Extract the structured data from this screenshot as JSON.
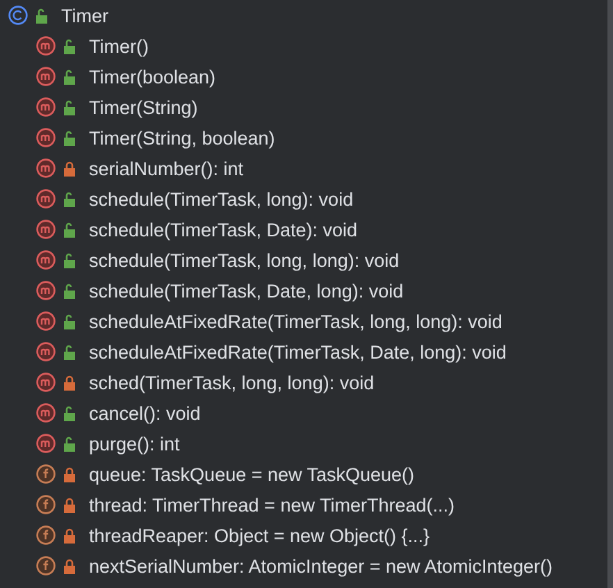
{
  "structure": {
    "label": "Timer",
    "kind": "class",
    "locked": false,
    "children": [
      {
        "label": "Timer()",
        "kind": "method",
        "locked": false
      },
      {
        "label": "Timer(boolean)",
        "kind": "method",
        "locked": false
      },
      {
        "label": "Timer(String)",
        "kind": "method",
        "locked": false
      },
      {
        "label": "Timer(String, boolean)",
        "kind": "method",
        "locked": false
      },
      {
        "label": "serialNumber(): int",
        "kind": "method",
        "locked": true
      },
      {
        "label": "schedule(TimerTask, long): void",
        "kind": "method",
        "locked": false
      },
      {
        "label": "schedule(TimerTask, Date): void",
        "kind": "method",
        "locked": false
      },
      {
        "label": "schedule(TimerTask, long, long): void",
        "kind": "method",
        "locked": false
      },
      {
        "label": "schedule(TimerTask, Date, long): void",
        "kind": "method",
        "locked": false
      },
      {
        "label": "scheduleAtFixedRate(TimerTask, long, long): void",
        "kind": "method",
        "locked": false
      },
      {
        "label": "scheduleAtFixedRate(TimerTask, Date, long): void",
        "kind": "method",
        "locked": false
      },
      {
        "label": "sched(TimerTask, long, long): void",
        "kind": "method",
        "locked": true
      },
      {
        "label": "cancel(): void",
        "kind": "method",
        "locked": false
      },
      {
        "label": "purge(): int",
        "kind": "method",
        "locked": false
      },
      {
        "label": "queue: TaskQueue = new TaskQueue()",
        "kind": "field",
        "locked": true
      },
      {
        "label": "thread: TimerThread = new TimerThread(...)",
        "kind": "field",
        "locked": true
      },
      {
        "label": "threadReaper: Object = new Object() {...}",
        "kind": "field",
        "locked": true
      },
      {
        "label": "nextSerialNumber: AtomicInteger = new AtomicInteger()",
        "kind": "field",
        "locked": true
      }
    ]
  }
}
